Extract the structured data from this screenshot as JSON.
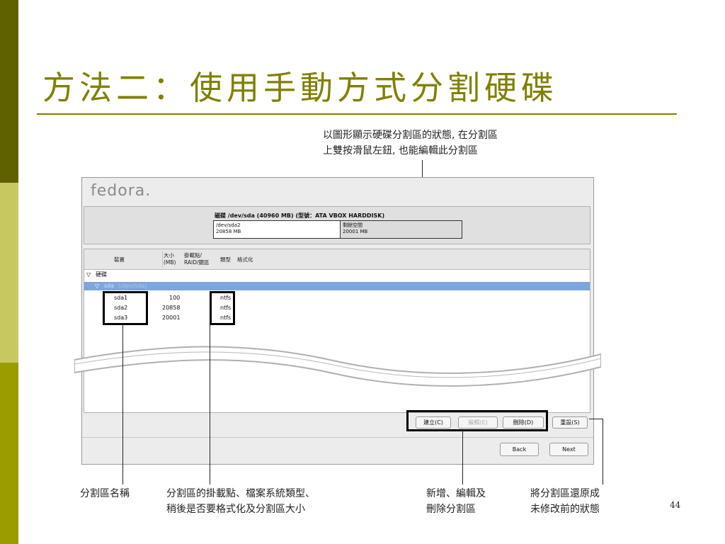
{
  "slide": {
    "title": "方法二：使用手動方式分割硬碟",
    "page_number": "44"
  },
  "callouts": {
    "top_line1": "以圖形顯示硬碟分割區的狀態, 在分割區",
    "top_line2": "上雙按滑鼠左鈕, 也能編輯此分割區",
    "bottom_names": "分割區名稱",
    "bottom_mount_line1": "分割區的掛載點、檔案系統類型、",
    "bottom_mount_line2": "稍後是否要格式化及分割區大小",
    "bottom_add_line1": "新增、編輯及",
    "bottom_add_line2": "刪除分割區",
    "bottom_reset_line1": "將分割區還原成",
    "bottom_reset_line2": "未修改前的狀態"
  },
  "installer": {
    "logo": "fedora.",
    "disk_header": "磁碟 /dev/sda (40960 MB) (型號：ATA VBOX HARDDISK)",
    "segment1_name": "/dev/sda2",
    "segment1_size": "20858 MB",
    "segment2_name": "剩餘空間",
    "segment2_size": "20001 MB",
    "columns": {
      "device": "裝置",
      "size_line1": "大小",
      "size_line2": "(MB)",
      "mount_line1": "掛載點/",
      "mount_line2": "RAID/鏡區",
      "type": "類型",
      "format": "格式化"
    },
    "tree": {
      "root": "硬碟",
      "disk": "sda",
      "disk_path": "(/dev/sda)"
    },
    "partitions": [
      {
        "name": "sda1",
        "size": "100",
        "type": "ntfs"
      },
      {
        "name": "sda2",
        "size": "20858",
        "type": "ntfs"
      },
      {
        "name": "sda3",
        "size": "20001",
        "type": "ntfs"
      }
    ],
    "buttons": {
      "create": "建立(C)",
      "edit": "編輯(E)",
      "delete": "刪除(D)",
      "reset": "重設(S)",
      "back": "Back",
      "next": "Next"
    }
  },
  "colors": {
    "accent": "#808000",
    "selection": "#7da6dc"
  }
}
